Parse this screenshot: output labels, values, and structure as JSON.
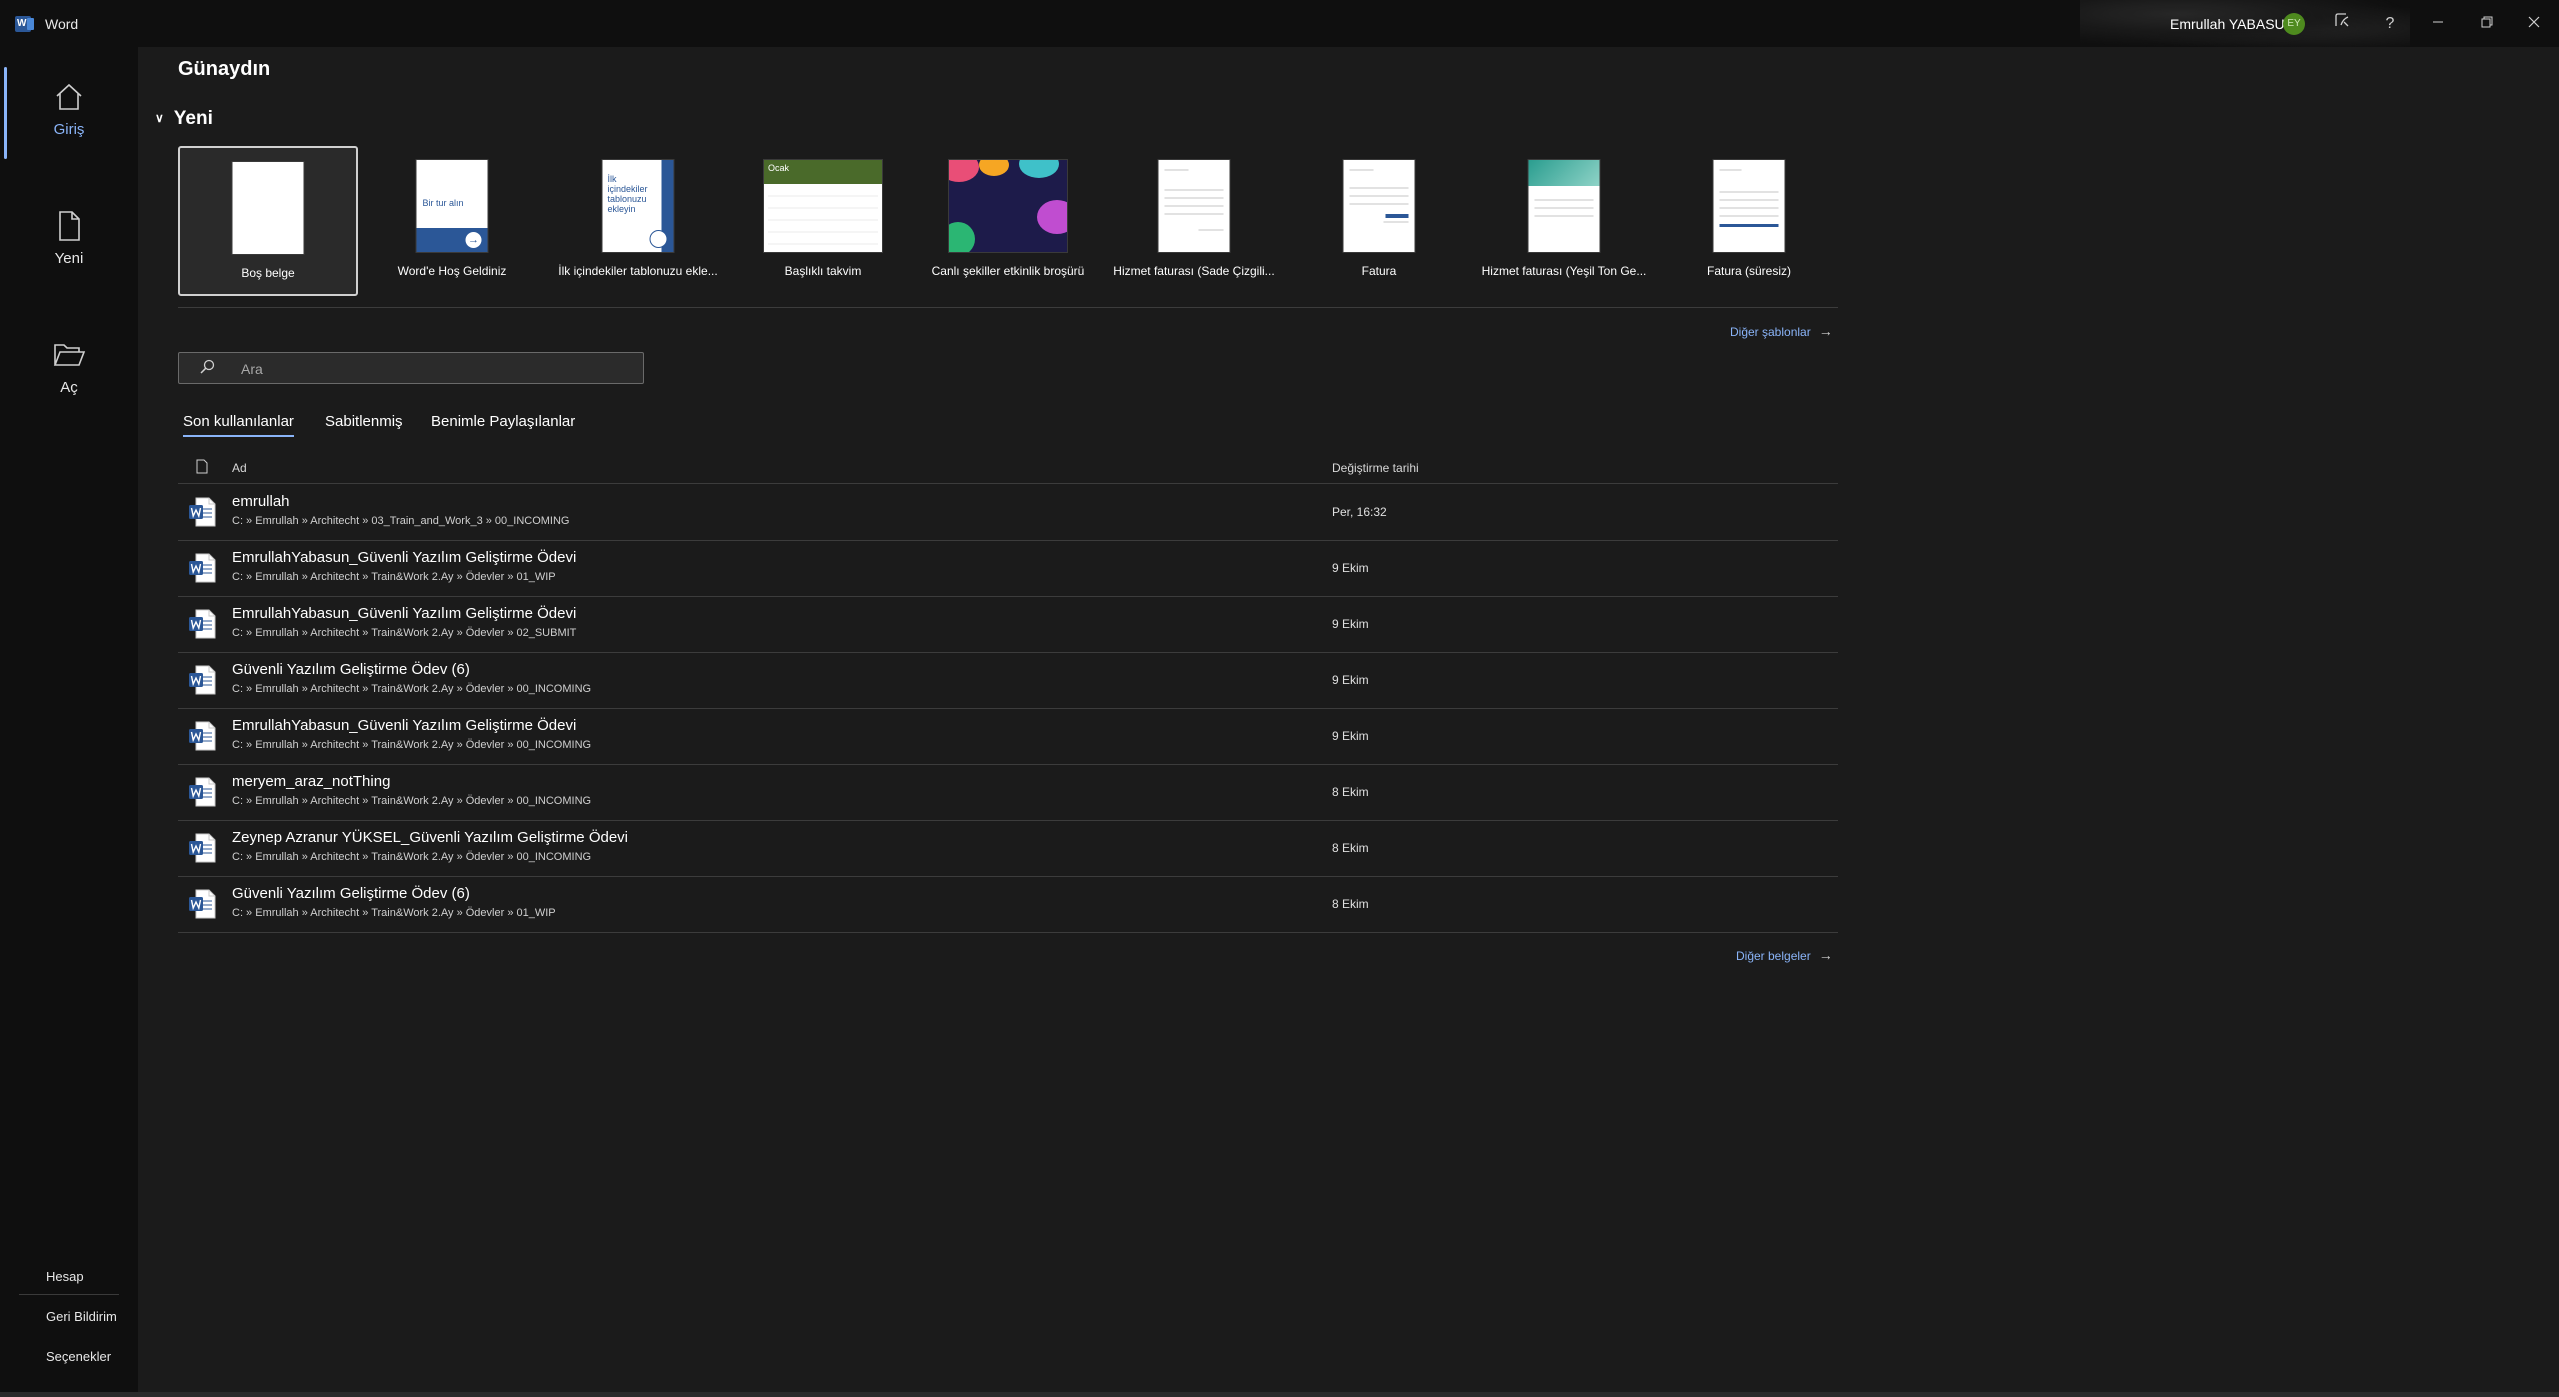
{
  "titlebar": {
    "app_title": "Word",
    "user_name": "Emrullah YABASUN",
    "avatar_initials": "EY",
    "icons": [
      "coauthor-icon",
      "help-icon",
      "minimize-icon",
      "restore-icon",
      "close-icon"
    ],
    "help_glyph": "?"
  },
  "nav": {
    "items": [
      {
        "label": "Giriş",
        "icon": "home-icon",
        "active": true
      },
      {
        "label": "Yeni",
        "icon": "new-document-icon",
        "active": false
      },
      {
        "label": "Aç",
        "icon": "folder-open-icon",
        "active": false
      }
    ],
    "bottom": [
      "Hesap",
      "Geri Bildirim",
      "Seçenekler"
    ]
  },
  "main": {
    "greeting": "Günaydın",
    "new_section": "Yeni",
    "templates": [
      {
        "label": "Boş belge"
      },
      {
        "label": "Word'e Hoş Geldiniz",
        "thumb_text": "Bir tur alın"
      },
      {
        "label": "İlk içindekiler tablonuzu ekle...",
        "thumb_text": "İlk içindekiler tablonuzu ekleyin"
      },
      {
        "label": "Başlıklı takvim",
        "thumb_text": "Ocak"
      },
      {
        "label": "Canlı şekiller etkinlik broşürü"
      },
      {
        "label": "Hizmet faturası (Sade Çizgili..."
      },
      {
        "label": "Fatura"
      },
      {
        "label": "Hizmet faturası (Yeşil Ton Ge..."
      },
      {
        "label": "Fatura (süresiz)"
      }
    ],
    "more_templates": "Diğer şablonlar",
    "search_placeholder": "Ara",
    "tabs": [
      "Son kullanılanlar",
      "Sabitlenmiş",
      "Benimle Paylaşılanlar"
    ],
    "columns": {
      "name": "Ad",
      "date": "Değiştirme tarihi"
    },
    "files": [
      {
        "name": "emrullah",
        "path": "C: » Emrullah » Architecht » 03_Train_and_Work_3 » 00_INCOMING",
        "date": "Per, 16:32"
      },
      {
        "name": "EmrullahYabasun_Güvenli Yazılım Geliştirme Ödevi",
        "path": "C: » Emrullah » Architecht » Train&Work 2.Ay » Ödevler » 01_WIP",
        "date": "9 Ekim"
      },
      {
        "name": "EmrullahYabasun_Güvenli Yazılım Geliştirme Ödevi",
        "path": "C: » Emrullah » Architecht » Train&Work 2.Ay » Ödevler » 02_SUBMIT",
        "date": "9 Ekim"
      },
      {
        "name": "Güvenli Yazılım Geliştirme Ödev (6)",
        "path": "C: » Emrullah » Architecht » Train&Work 2.Ay » Ödevler » 00_INCOMING",
        "date": "9 Ekim"
      },
      {
        "name": "EmrullahYabasun_Güvenli Yazılım Geliştirme Ödevi",
        "path": "C: » Emrullah » Architecht » Train&Work 2.Ay » Ödevler » 00_INCOMING",
        "date": "9 Ekim"
      },
      {
        "name": "meryem_araz_notThing",
        "path": "C: » Emrullah » Architecht » Train&Work 2.Ay » Ödevler » 00_INCOMING",
        "date": "8 Ekim"
      },
      {
        "name": "Zeynep Azranur YÜKSEL_Güvenli Yazılım Geliştirme Ödevi",
        "path": "C: » Emrullah » Architecht » Train&Work 2.Ay » Ödevler » 00_INCOMING",
        "date": "8 Ekim"
      },
      {
        "name": "Güvenli Yazılım Geliştirme Ödev (6)",
        "path": "C: » Emrullah » Architecht » Train&Work 2.Ay » Ödevler » 01_WIP",
        "date": "8 Ekim"
      }
    ],
    "more_documents": "Diğer belgeler"
  },
  "colors": {
    "accent": "#8ab4f8",
    "background": "#1b1b1b",
    "chrome": "#0f0f0f",
    "word_blue": "#2b5797"
  }
}
